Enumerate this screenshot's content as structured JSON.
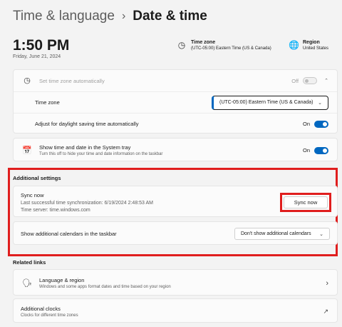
{
  "breadcrumb": {
    "parent": "Time & language",
    "separator": "›",
    "current": "Date & time"
  },
  "clock": {
    "time": "1:50 PM",
    "date": "Friday, June 21, 2024"
  },
  "summary": {
    "time_zone": {
      "title": "Time zone",
      "value": "(UTC-05:00) Eastern Time (US & Canada)"
    },
    "region": {
      "title": "Region",
      "value": "United States"
    }
  },
  "settings": {
    "auto_timezone": {
      "label": "Set time zone automatically",
      "state": "Off"
    },
    "time_zone": {
      "label": "Time zone",
      "selected": "(UTC-05:00) Eastern Time (US & Canada)"
    },
    "dst": {
      "label": "Adjust for daylight saving time automatically",
      "state": "On"
    },
    "tray": {
      "label": "Show time and date in the System tray",
      "description": "Turn this off to hide your time and date information on the taskbar",
      "state": "On"
    }
  },
  "additional_settings": {
    "title": "Additional settings",
    "sync": {
      "title": "Sync now",
      "last_sync": "Last successful time synchronization: 6/19/2024 2:48:53 AM",
      "server": "Time server: time.windows.com",
      "button": "Sync now"
    },
    "calendars": {
      "label": "Show additional calendars in the taskbar",
      "selected": "Don't show additional calendars"
    }
  },
  "related_links": {
    "title": "Related links",
    "language_region": {
      "title": "Language & region",
      "description": "Windows and some apps format dates and time based on your region"
    },
    "additional_clocks": {
      "title": "Additional clocks",
      "description": "Clocks for different time zones"
    }
  },
  "colors": {
    "accent": "#0067c0",
    "highlight": "#e01e1e",
    "background": "#f3f3f3"
  },
  "icons": [
    "clock-globe-icon",
    "globe-icon",
    "timezone-auto-icon",
    "calendar-clock-icon",
    "language-icon",
    "chevron-right-icon",
    "external-link-icon",
    "chevron-down-icon",
    "chevron-up-icon"
  ]
}
